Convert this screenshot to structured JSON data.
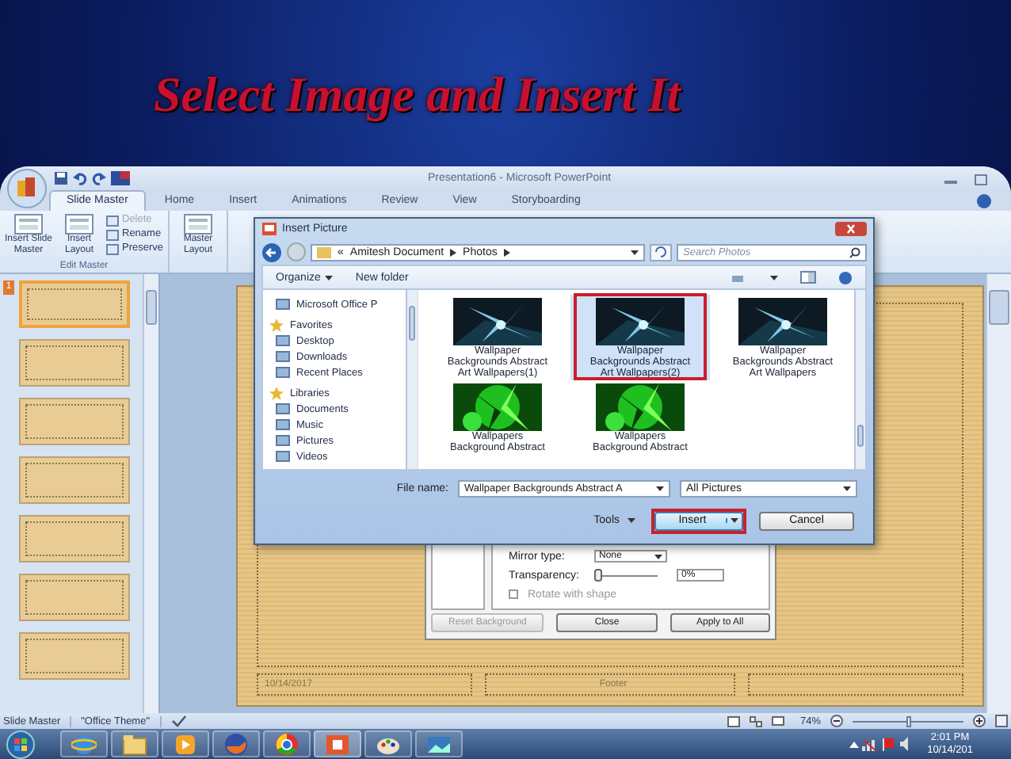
{
  "slide_title": "Select Image and Insert It",
  "app": {
    "title": "Presentation6 - Microsoft PowerPoint",
    "tabs": [
      {
        "label": "Slide Master",
        "selected": true
      },
      {
        "label": "Home",
        "selected": false
      },
      {
        "label": "Insert",
        "selected": false
      },
      {
        "label": "Animations",
        "selected": false
      },
      {
        "label": "Review",
        "selected": false
      },
      {
        "label": "View",
        "selected": false
      },
      {
        "label": "Storyboarding",
        "selected": false
      }
    ],
    "ribbon": {
      "buttons": [
        {
          "label": "Insert Slide Master",
          "kind": "large",
          "disabled": false
        },
        {
          "label": "Insert Layout",
          "kind": "large",
          "disabled": false
        },
        {
          "label": "Delete",
          "kind": "small",
          "disabled": true
        },
        {
          "label": "Rename",
          "kind": "small",
          "disabled": false
        },
        {
          "label": "Preserve",
          "kind": "small",
          "disabled": false
        },
        {
          "label": "Master Layout",
          "kind": "large",
          "disabled": false
        }
      ],
      "group_label": "Edit Master"
    },
    "slides": [
      {
        "number": "1",
        "selected": true
      },
      {
        "selected": false
      },
      {
        "selected": false
      },
      {
        "selected": false
      },
      {
        "selected": false
      },
      {
        "selected": false
      },
      {
        "selected": false
      }
    ],
    "slide": {
      "date": "10/14/2017",
      "footer": "Footer"
    },
    "status_bar": {
      "view": "Slide Master",
      "theme": "\"Office Theme\"",
      "zoom": {
        "reading": "74%",
        "level": 0.5
      }
    },
    "taskbar": {
      "time": "2:01 PM",
      "date": "10/14/201"
    }
  },
  "insert_dialog": {
    "title": "Insert Picture",
    "path_prefix": "«",
    "path": [
      "Amitesh Document",
      "Photos"
    ],
    "search": {
      "placeholder": "Search Photos"
    },
    "toolbar": [
      "Organize",
      "New folder"
    ],
    "nav": [
      {
        "label": "Microsoft Office P",
        "kind": "item"
      },
      {
        "label": "Favorites",
        "kind": "group"
      },
      {
        "label": "Desktop",
        "kind": "item"
      },
      {
        "label": "Downloads",
        "kind": "item"
      },
      {
        "label": "Recent Places",
        "kind": "item"
      },
      {
        "label": "Libraries",
        "kind": "group"
      },
      {
        "label": "Documents",
        "kind": "item"
      },
      {
        "label": "Music",
        "kind": "item"
      },
      {
        "label": "Pictures",
        "kind": "item"
      },
      {
        "label": "Videos",
        "kind": "item"
      }
    ],
    "files": [
      {
        "name": "Wallpaper Backgrounds Abstract Art Wallpapers(1)",
        "selected": false,
        "highlighted": false
      },
      {
        "name": "Wallpaper Backgrounds Abstract Art Wallpapers(2)",
        "selected": true,
        "highlighted": true
      },
      {
        "name": "Wallpaper Backgrounds Abstract Art Wallpapers",
        "selected": false,
        "highlighted": false
      },
      {
        "name": "Wallpapers Background Abstract",
        "selected": false,
        "highlighted": false
      },
      {
        "name": "Wallpapers Background Abstract",
        "selected": false,
        "highlighted": false
      }
    ],
    "file_name": {
      "label": "File name:",
      "value": "Wallpaper Backgrounds Abstract A"
    },
    "filter": "All Pictures",
    "tools": "Tools",
    "buttons": [
      {
        "label": "Insert",
        "highlighted": true
      },
      {
        "label": "Cancel",
        "highlighted": false
      }
    ]
  },
  "format_dialog": {
    "mirror": {
      "label": "Mirror type:",
      "value": "None"
    },
    "transparency": {
      "label": "Transparency:",
      "level": 0,
      "reading": "0%"
    },
    "rotate": {
      "label": "Rotate with shape",
      "checked": false
    },
    "buttons": [
      {
        "label": "Reset Background",
        "disabled": true
      },
      {
        "label": "Close",
        "disabled": false
      },
      {
        "label": "Apply to All",
        "disabled": false
      }
    ]
  }
}
